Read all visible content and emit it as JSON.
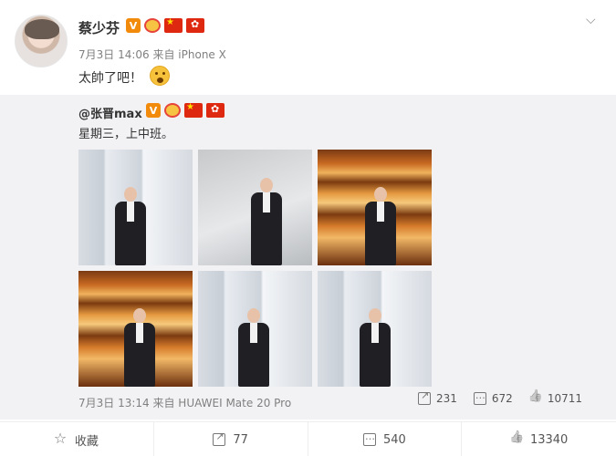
{
  "post": {
    "author": "蔡少芬",
    "meta": "7月3日 14:06 来自 iPhone X",
    "text": "太帥了吧！",
    "badges": {
      "vip_letter": "V"
    }
  },
  "repost": {
    "author": "@张晋max",
    "text": "星期三，上中班。",
    "meta": "7月3日 13:14 来自 HUAWEI Mate 20 Pro",
    "stats": {
      "forward_count": "231",
      "comment_count": "672",
      "like_count": "10711"
    },
    "badges": {
      "vip_letter": "V"
    }
  },
  "actions": {
    "favorite_label": "收藏",
    "forward_count": "77",
    "comment_count": "540",
    "like_count": "13340"
  },
  "icons": {
    "chevron": "chevron-down-icon",
    "forward": "share-icon",
    "comment": "comment-icon",
    "like": "thumbs-up-icon",
    "favorite": "star-icon"
  },
  "colors": {
    "vip": "#f28a0c",
    "repost_bg": "#f2f2f5",
    "flag_red": "#de2910"
  }
}
